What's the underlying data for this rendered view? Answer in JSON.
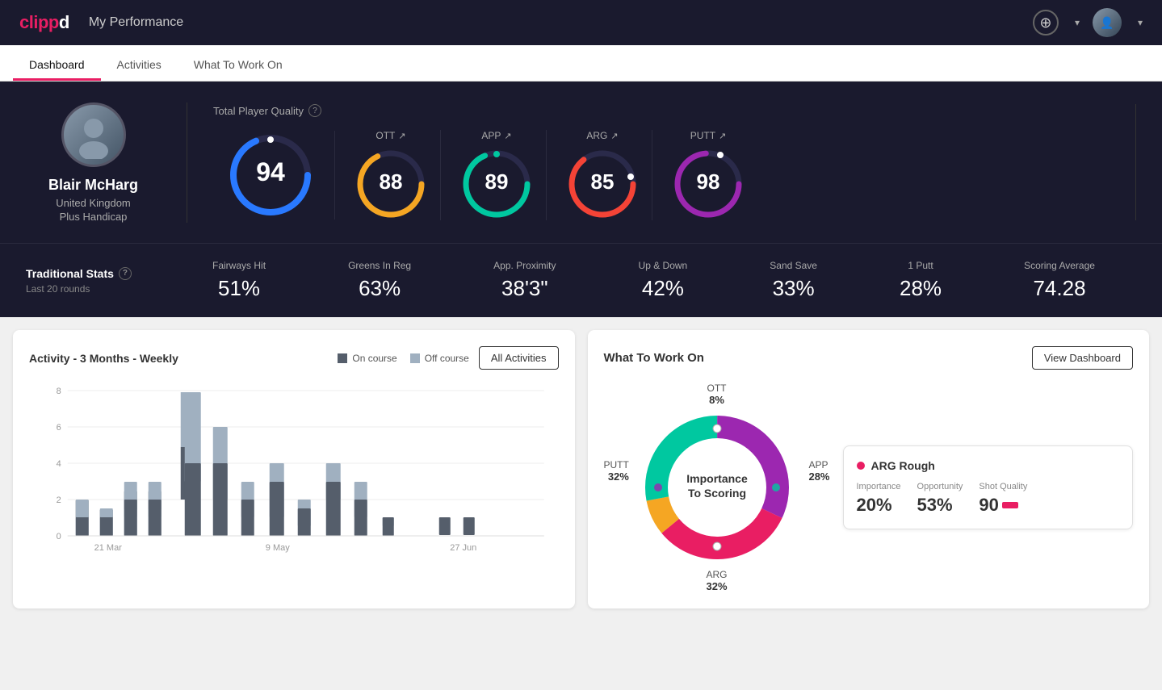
{
  "app": {
    "logo_clip": "clip",
    "logo_pd": "pd",
    "logo_full": "clippd"
  },
  "header": {
    "title": "My Performance",
    "add_icon": "⊕",
    "chevron": "▾"
  },
  "tabs": [
    {
      "id": "dashboard",
      "label": "Dashboard",
      "active": true
    },
    {
      "id": "activities",
      "label": "Activities",
      "active": false
    },
    {
      "id": "what-to-work-on",
      "label": "What To Work On",
      "active": false
    }
  ],
  "player": {
    "name": "Blair McHarg",
    "country": "United Kingdom",
    "handicap": "Plus Handicap"
  },
  "total_quality": {
    "label": "Total Player Quality",
    "value": 94,
    "color": "#2979ff"
  },
  "gauges": [
    {
      "id": "ott",
      "label": "OTT",
      "value": 88,
      "color": "#f5a623",
      "trend": "↗"
    },
    {
      "id": "app",
      "label": "APP",
      "value": 89,
      "color": "#00c8a0",
      "trend": "↗"
    },
    {
      "id": "arg",
      "label": "ARG",
      "value": 85,
      "color": "#f44336",
      "trend": "↗"
    },
    {
      "id": "putt",
      "label": "PUTT",
      "value": 98,
      "color": "#9c27b0",
      "trend": "↗"
    }
  ],
  "traditional_stats": {
    "label": "Traditional Stats",
    "sub": "Last 20 rounds",
    "items": [
      {
        "name": "Fairways Hit",
        "value": "51%"
      },
      {
        "name": "Greens In Reg",
        "value": "63%"
      },
      {
        "name": "App. Proximity",
        "value": "38'3\""
      },
      {
        "name": "Up & Down",
        "value": "42%"
      },
      {
        "name": "Sand Save",
        "value": "33%"
      },
      {
        "name": "1 Putt",
        "value": "28%"
      },
      {
        "name": "Scoring Average",
        "value": "74.28"
      }
    ]
  },
  "activity_chart": {
    "title": "Activity - 3 Months - Weekly",
    "legend": [
      {
        "label": "On course",
        "color": "#555e6b"
      },
      {
        "label": "Off course",
        "color": "#a0b0c0"
      }
    ],
    "all_activities_btn": "All Activities",
    "x_labels": [
      "21 Mar",
      "9 May",
      "27 Jun"
    ],
    "y_labels": [
      "0",
      "2",
      "4",
      "6",
      "8"
    ]
  },
  "what_to_work_on": {
    "title": "What To Work On",
    "view_dashboard_btn": "View Dashboard",
    "donut_center_line1": "Importance",
    "donut_center_line2": "To Scoring",
    "segments": [
      {
        "label": "OTT",
        "value": "8%",
        "color": "#f5a623",
        "position": "top"
      },
      {
        "label": "APP",
        "value": "28%",
        "color": "#00c8a0",
        "position": "right"
      },
      {
        "label": "ARG",
        "value": "32%",
        "color": "#f44336",
        "position": "bottom"
      },
      {
        "label": "PUTT",
        "value": "32%",
        "color": "#9c27b0",
        "position": "left"
      }
    ],
    "info_card": {
      "title": "ARG Rough",
      "dot_color": "#e91e63",
      "metrics": [
        {
          "name": "Importance",
          "value": "20%"
        },
        {
          "name": "Opportunity",
          "value": "53%"
        },
        {
          "name": "Shot Quality",
          "value": "90"
        }
      ]
    }
  }
}
